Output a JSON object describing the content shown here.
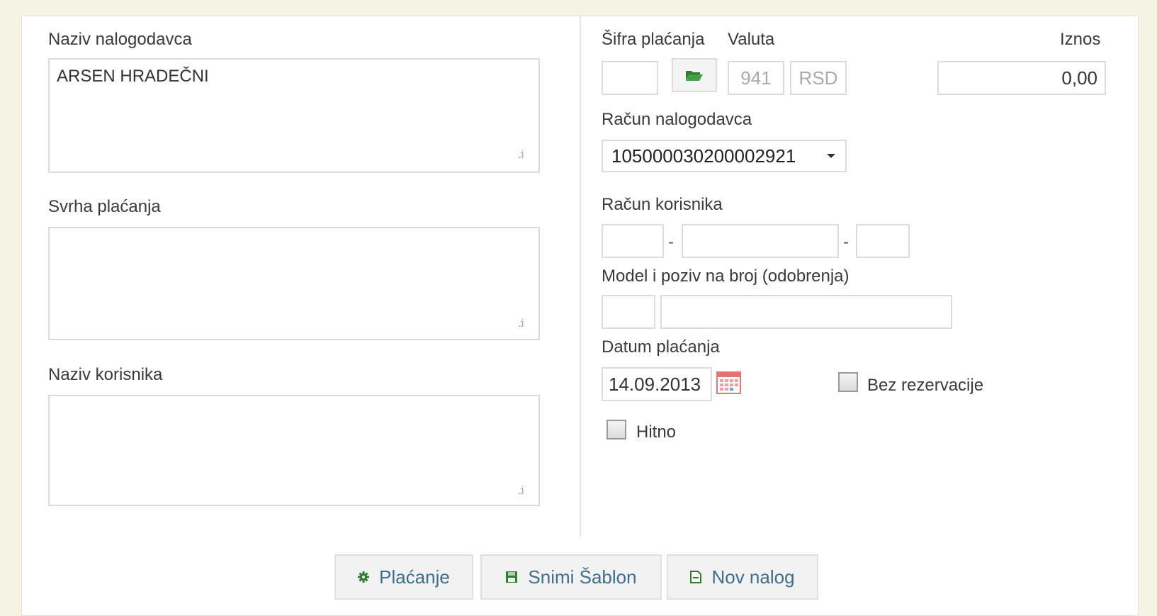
{
  "labels": {
    "payer_name": "Naziv nalogodavca",
    "payment_purpose": "Svrha plaćanja",
    "recipient_name": "Naziv korisnika",
    "payment_code": "Šifra plaćanja",
    "currency": "Valuta",
    "amount": "Iznos",
    "payer_account": "Račun nalogodavca",
    "recipient_account": "Račun korisnika",
    "model_reference": "Model i poziv na broj (odobrenja)",
    "payment_date": "Datum plaćanja",
    "no_reservation": "Bez rezervacije",
    "urgent": "Hitno"
  },
  "fields": {
    "payer_name_value": "ARSEN HRADEČNI",
    "payment_purpose_value": "",
    "recipient_name_value": "",
    "payment_code_value": "",
    "currency_code": "941",
    "currency_symbol": "RSD",
    "amount_value": "0,00",
    "payer_account_selected": "105000030200002921",
    "recipient_account_part1": "",
    "recipient_account_part2": "",
    "recipient_account_part3": "",
    "model_value": "",
    "reference_value": "",
    "payment_date_value": "14.09.2013",
    "no_reservation_checked": false,
    "urgent_checked": false
  },
  "separators": {
    "account_dash": "-"
  },
  "buttons": {
    "pay": "Plaćanje",
    "save_template": "Snimi Šablon",
    "new_order": "Nov nalog"
  },
  "icons": {
    "folder": "folder-open-icon",
    "calendar": "calendar-icon",
    "pay": "gear-icon",
    "save": "save-icon",
    "new": "new-document-icon"
  },
  "colors": {
    "page_bg": "#f5f3e3",
    "button_text": "#3d6f8c",
    "icon_green": "#2e7d32"
  }
}
